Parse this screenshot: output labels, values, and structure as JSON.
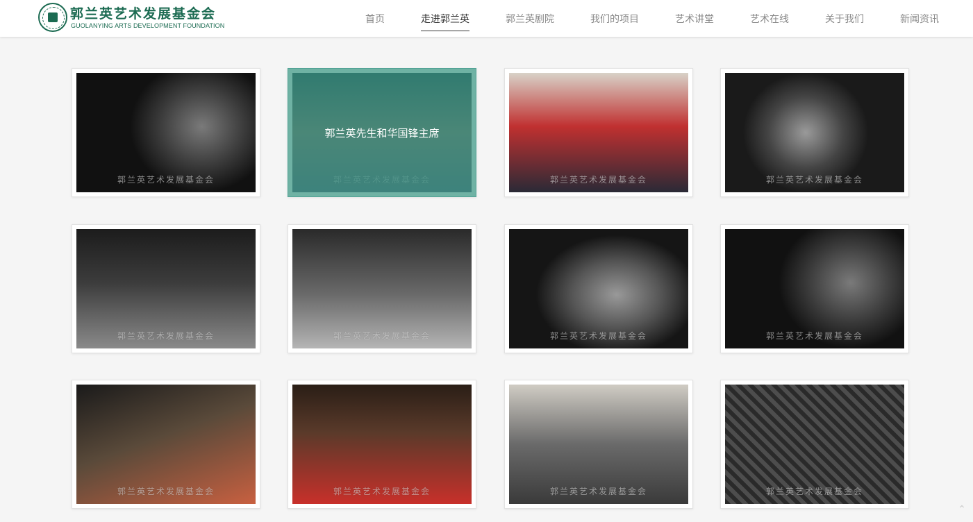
{
  "brand": {
    "name_cn": "郭兰英艺术发展基金会",
    "name_en": "GUOLANYING ARTS DEVELOPMENT FOUNDATION"
  },
  "nav": {
    "items": [
      {
        "label": "首页",
        "active": false
      },
      {
        "label": "走进郭兰英",
        "active": true
      },
      {
        "label": "郭兰英剧院",
        "active": false
      },
      {
        "label": "我们的项目",
        "active": false
      },
      {
        "label": "艺术讲堂",
        "active": false
      },
      {
        "label": "艺术在线",
        "active": false
      },
      {
        "label": "关于我们",
        "active": false
      },
      {
        "label": "新闻资讯",
        "active": false
      }
    ]
  },
  "gallery": {
    "watermark": "郭兰英艺术发展基金会",
    "hover_caption": "郭兰英先生和华国锋主席",
    "photos": [
      {
        "style": "p-bw1",
        "color": false
      },
      {
        "style": "p-c1",
        "color": true
      },
      {
        "style": "p-c2",
        "color": true
      },
      {
        "style": "p-bw2",
        "color": false
      },
      {
        "style": "p-bw3",
        "color": false
      },
      {
        "style": "p-bw5",
        "color": false
      },
      {
        "style": "p-bw4",
        "color": false
      },
      {
        "style": "p-bw1",
        "color": false
      },
      {
        "style": "p-c3",
        "color": true
      },
      {
        "style": "p-c4",
        "color": true
      },
      {
        "style": "p-c5",
        "color": false
      },
      {
        "style": "p-bw6",
        "color": false
      }
    ]
  },
  "colors": {
    "brand_green": "#1c6b52",
    "hover_teal": "#4fa294"
  },
  "icons": {
    "scroll_top": "chevron-up-icon"
  }
}
